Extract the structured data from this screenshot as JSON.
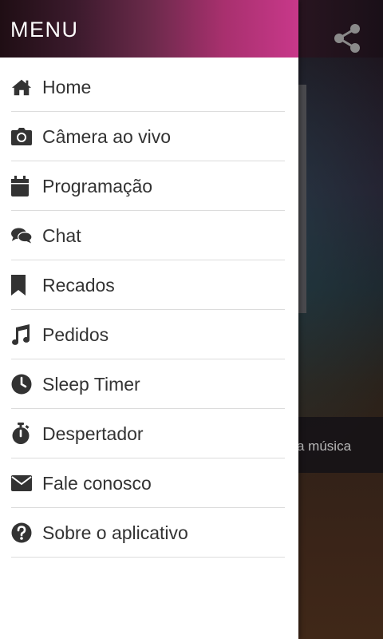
{
  "drawer": {
    "title": "MENU"
  },
  "menu": {
    "items": [
      {
        "label": "Home",
        "icon": "home-icon"
      },
      {
        "label": "Câmera ao vivo",
        "icon": "camera-icon"
      },
      {
        "label": "Programação",
        "icon": "calendar-icon"
      },
      {
        "label": "Chat",
        "icon": "chat-icon"
      },
      {
        "label": "Recados",
        "icon": "bookmark-icon"
      },
      {
        "label": "Pedidos",
        "icon": "music-note-icon"
      },
      {
        "label": "Sleep Timer",
        "icon": "clock-icon"
      },
      {
        "label": "Despertador",
        "icon": "stopwatch-icon"
      },
      {
        "label": "Fale conosco",
        "icon": "envelope-icon"
      },
      {
        "label": "Sobre o aplicativo",
        "icon": "question-circle-icon"
      }
    ]
  },
  "background": {
    "now_playing_text": "a música",
    "share_icon": "share-icon"
  },
  "colors": {
    "drawer_bg": "#ffffff",
    "header_gradient_end": "#c8388a",
    "text": "#333333"
  }
}
